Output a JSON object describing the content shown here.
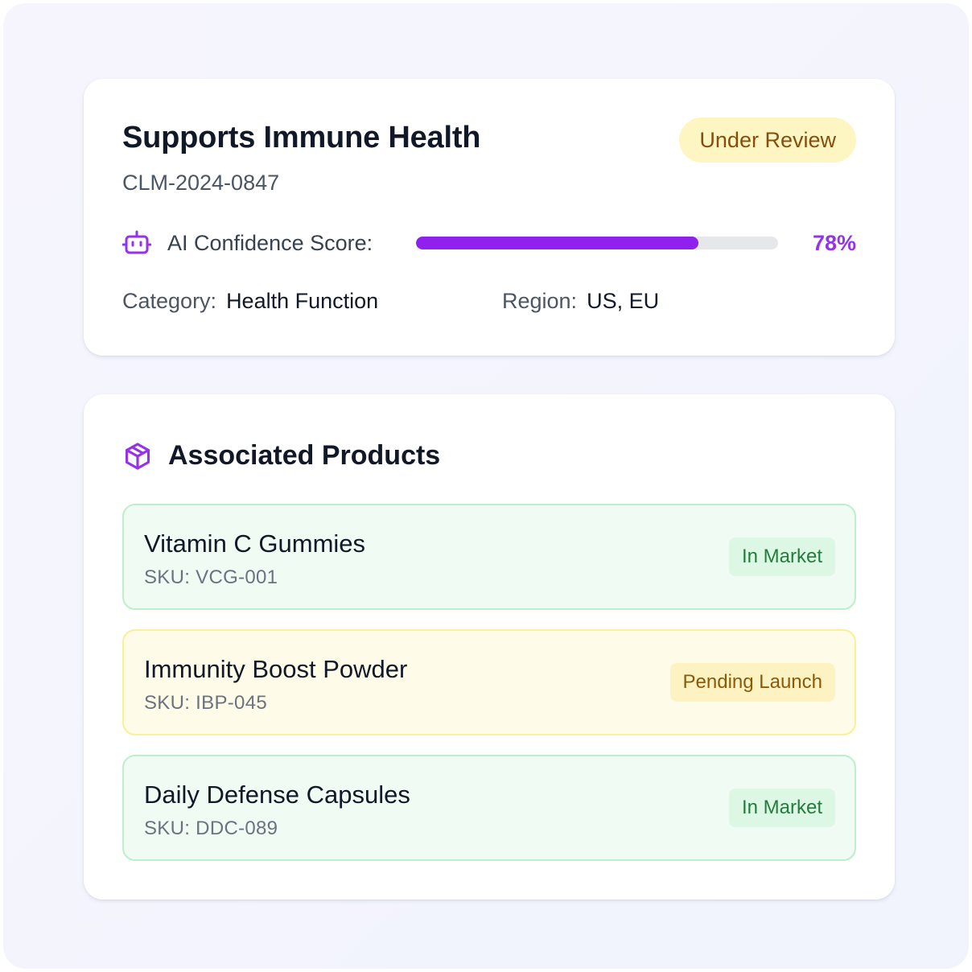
{
  "claim": {
    "title": "Supports Immune Health",
    "id": "CLM-2024-0847",
    "status": "Under Review",
    "confidence_label": "AI Confidence Score:",
    "confidence_value": 0.78,
    "confidence_text": "78%",
    "category_label": "Category:",
    "category_value": "Health Function",
    "region_label": "Region:",
    "region_value": "US, EU",
    "icon": "robot-icon"
  },
  "products": {
    "title": "Associated Products",
    "icon": "package-icon",
    "items": [
      {
        "name": "Vitamin C Gummies",
        "sku": "SKU: VCG-001",
        "status": "In Market"
      },
      {
        "name": "Immunity Boost Powder",
        "sku": "SKU: IBP-045",
        "status": "Pending Launch"
      },
      {
        "name": "Daily Defense Capsules",
        "sku": "SKU: DDC-089",
        "status": "In Market"
      }
    ]
  },
  "colors": {
    "accent": "#9333ea",
    "status_review_bg": "#fdf6c3",
    "in_market": "#257a3e",
    "pending": "#8a5a0a"
  }
}
